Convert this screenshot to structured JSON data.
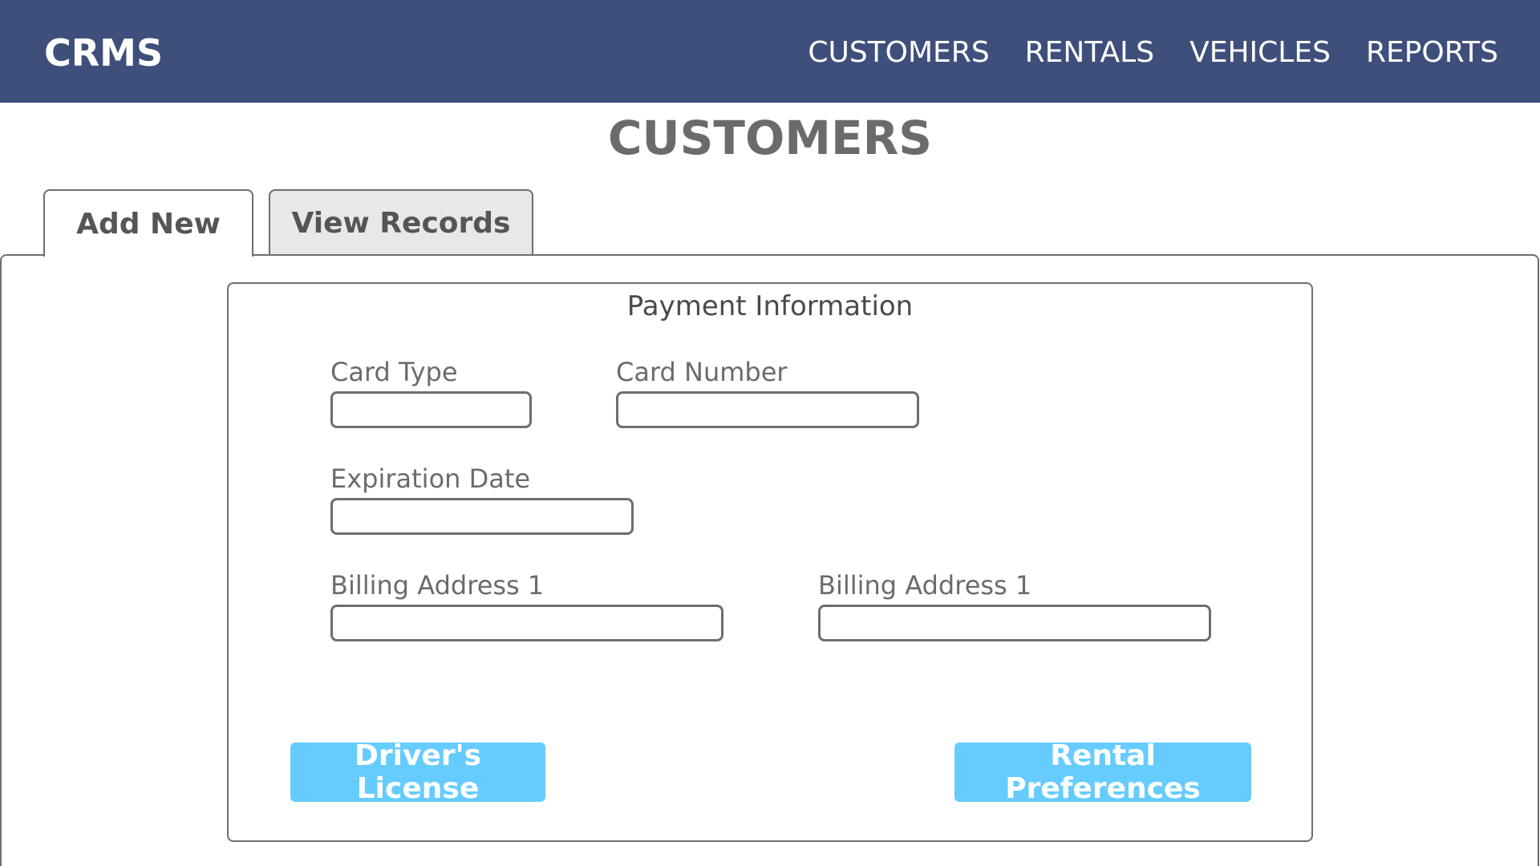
{
  "header": {
    "brand": "CRMS",
    "nav": [
      "CUSTOMERS",
      "RENTALS",
      "VEHICLES",
      "REPORTS"
    ]
  },
  "page": {
    "title": "CUSTOMERS"
  },
  "tabs": {
    "add_new": "Add New",
    "view_records": "View Records",
    "active": "Add New"
  },
  "panel": {
    "title": "Payment Information",
    "fields": {
      "card_type": {
        "label": "Card Type",
        "value": ""
      },
      "card_number": {
        "label": "Card Number",
        "value": ""
      },
      "expiration_date": {
        "label": "Expiration Date",
        "value": ""
      },
      "billing_address_left": {
        "label": "Billing Address 1",
        "value": ""
      },
      "billing_address_right": {
        "label": "Billing Address 1",
        "value": ""
      }
    },
    "buttons": {
      "drivers_license": "Driver's License",
      "rental_preferences": "Rental Preferences"
    }
  },
  "colors": {
    "header_bg": "#3f4f7b",
    "button_bg": "#66ccff",
    "inactive_tab_bg": "#e8e8e8",
    "border": "#6e6e6e",
    "title_text": "#6b6b6b"
  }
}
